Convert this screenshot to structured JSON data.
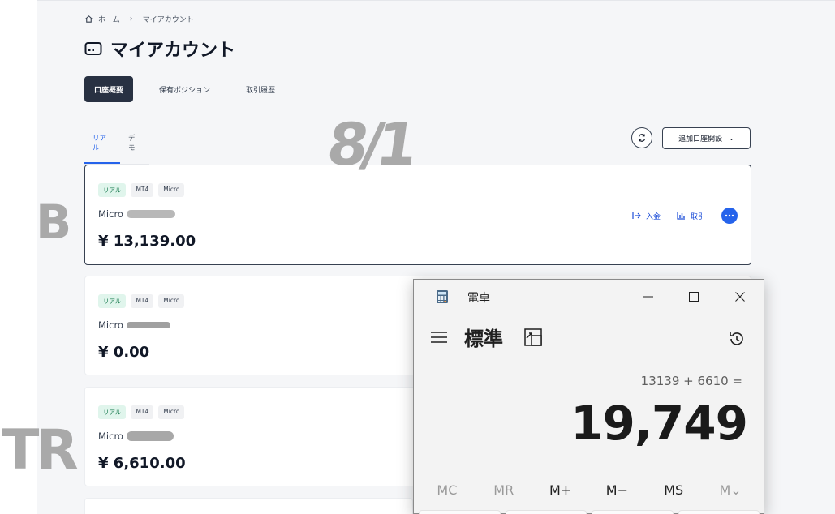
{
  "breadcrumb": {
    "home": "ホーム",
    "current": "マイアカウント"
  },
  "page_title": "マイアカウント",
  "tabs": [
    {
      "label": "口座概要",
      "active": true
    },
    {
      "label": "保有ポジション",
      "active": false
    },
    {
      "label": "取引履歴",
      "active": false
    }
  ],
  "subtabs": [
    {
      "label": "リアル",
      "active": true
    },
    {
      "label": "デモ",
      "active": false
    }
  ],
  "add_account_label": "追加口座開設",
  "accounts": [
    {
      "badges": [
        "リアル",
        "MT4",
        "Micro"
      ],
      "name": "Micro",
      "balance": "¥ 13,139.00",
      "selected": true
    },
    {
      "badges": [
        "リアル",
        "MT4",
        "Micro"
      ],
      "name": "Micro",
      "balance": "¥ 0.00",
      "selected": false
    },
    {
      "badges": [
        "リアル",
        "MT4",
        "Micro"
      ],
      "name": "Micro",
      "balance": "¥ 6,610.00",
      "selected": false
    }
  ],
  "actions": {
    "deposit": "入金",
    "trade": "取引"
  },
  "calculator": {
    "title": "電卓",
    "mode": "標準",
    "expression": "13139 + 6610 =",
    "result": "19,749",
    "memory": [
      {
        "label": "MC",
        "enabled": false
      },
      {
        "label": "MR",
        "enabled": false
      },
      {
        "label": "M+",
        "enabled": true
      },
      {
        "label": "M−",
        "enabled": true
      },
      {
        "label": "MS",
        "enabled": true
      },
      {
        "label": "M⌄",
        "enabled": false
      }
    ]
  },
  "handwriting": {
    "b": "B",
    "tr": "TR",
    "date": "8/1"
  },
  "colors": {
    "accent": "#2563eb",
    "active_tab": "#283142",
    "real_badge": "#e0f5ec"
  }
}
